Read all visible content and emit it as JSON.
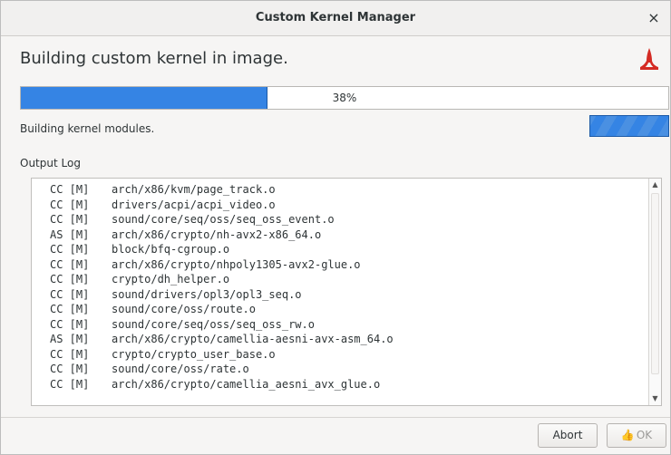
{
  "window": {
    "title": "Custom Kernel Manager",
    "close_glyph": "×"
  },
  "heading": "Building custom kernel in image.",
  "logo_icon": "red-ribbon-logo",
  "progress": {
    "value": 0.38,
    "label": "38%"
  },
  "status": "Building kernel modules.",
  "log": {
    "label": "Output Log",
    "lines": [
      {
        "prefix": "CC [M]",
        "path": "arch/x86/kvm/page_track.o"
      },
      {
        "prefix": "CC [M]",
        "path": "drivers/acpi/acpi_video.o"
      },
      {
        "prefix": "CC [M]",
        "path": "sound/core/seq/oss/seq_oss_event.o"
      },
      {
        "prefix": "AS [M]",
        "path": "arch/x86/crypto/nh-avx2-x86_64.o"
      },
      {
        "prefix": "CC [M]",
        "path": "block/bfq-cgroup.o"
      },
      {
        "prefix": "CC [M]",
        "path": "arch/x86/crypto/nhpoly1305-avx2-glue.o"
      },
      {
        "prefix": "CC [M]",
        "path": "crypto/dh_helper.o"
      },
      {
        "prefix": "CC [M]",
        "path": "sound/drivers/opl3/opl3_seq.o"
      },
      {
        "prefix": "CC [M]",
        "path": "sound/core/oss/route.o"
      },
      {
        "prefix": "CC [M]",
        "path": "sound/core/seq/oss/seq_oss_rw.o"
      },
      {
        "prefix": "AS [M]",
        "path": "arch/x86/crypto/camellia-aesni-avx-asm_64.o"
      },
      {
        "prefix": "CC [M]",
        "path": "crypto/crypto_user_base.o"
      },
      {
        "prefix": "CC [M]",
        "path": "sound/core/oss/rate.o"
      },
      {
        "prefix": "CC [M]",
        "path": "arch/x86/crypto/camellia_aesni_avx_glue.o"
      }
    ]
  },
  "buttons": {
    "abort": "Abort",
    "ok": "OK",
    "ok_icon": "thumbs-up-icon"
  },
  "colors": {
    "accent": "#3584e4",
    "logo_red": "#d42b24"
  }
}
